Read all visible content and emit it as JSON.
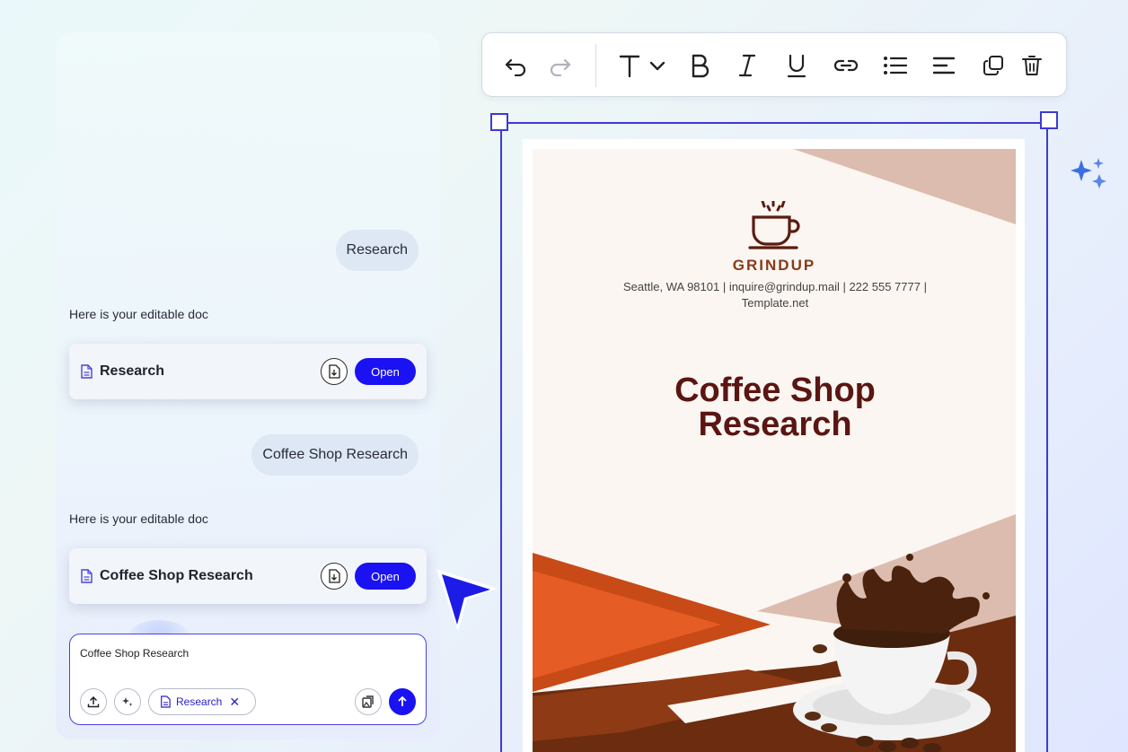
{
  "chat": {
    "messages": [
      {
        "role": "user",
        "text": "Research"
      },
      {
        "role": "assistant",
        "text": "Here is your editable doc",
        "doc_title": "Research",
        "open_label": "Open"
      },
      {
        "role": "user",
        "text": "Coffee Shop Research"
      },
      {
        "role": "assistant",
        "text": "Here is your editable doc",
        "doc_title": "Coffee Shop Research",
        "open_label": "Open"
      }
    ],
    "composer": {
      "value": "Coffee Shop Research",
      "attachment_chip": "Research"
    }
  },
  "toolbar": {
    "icons": [
      "undo-icon",
      "redo-icon",
      "text-style-icon",
      "bold-icon",
      "italic-icon",
      "underline-icon",
      "link-icon",
      "list-icon",
      "align-left-icon",
      "duplicate-icon",
      "delete-icon"
    ]
  },
  "document": {
    "brand": "GRINDUP",
    "contact_line1": "Seattle, WA 98101 | inquire@grindup.mail  | 222 555 7777 |",
    "contact_line2": "Template.net",
    "title_line1": "Coffee Shop",
    "title_line2": "Research"
  },
  "colors": {
    "accent": "#1a12f2",
    "selection": "#3d3ad6",
    "brand_brown": "#8a3a18",
    "title_maroon": "#5a1612",
    "orange": "#e05a22",
    "dark_brown": "#6a2a12",
    "beige": "#dcbcae"
  }
}
